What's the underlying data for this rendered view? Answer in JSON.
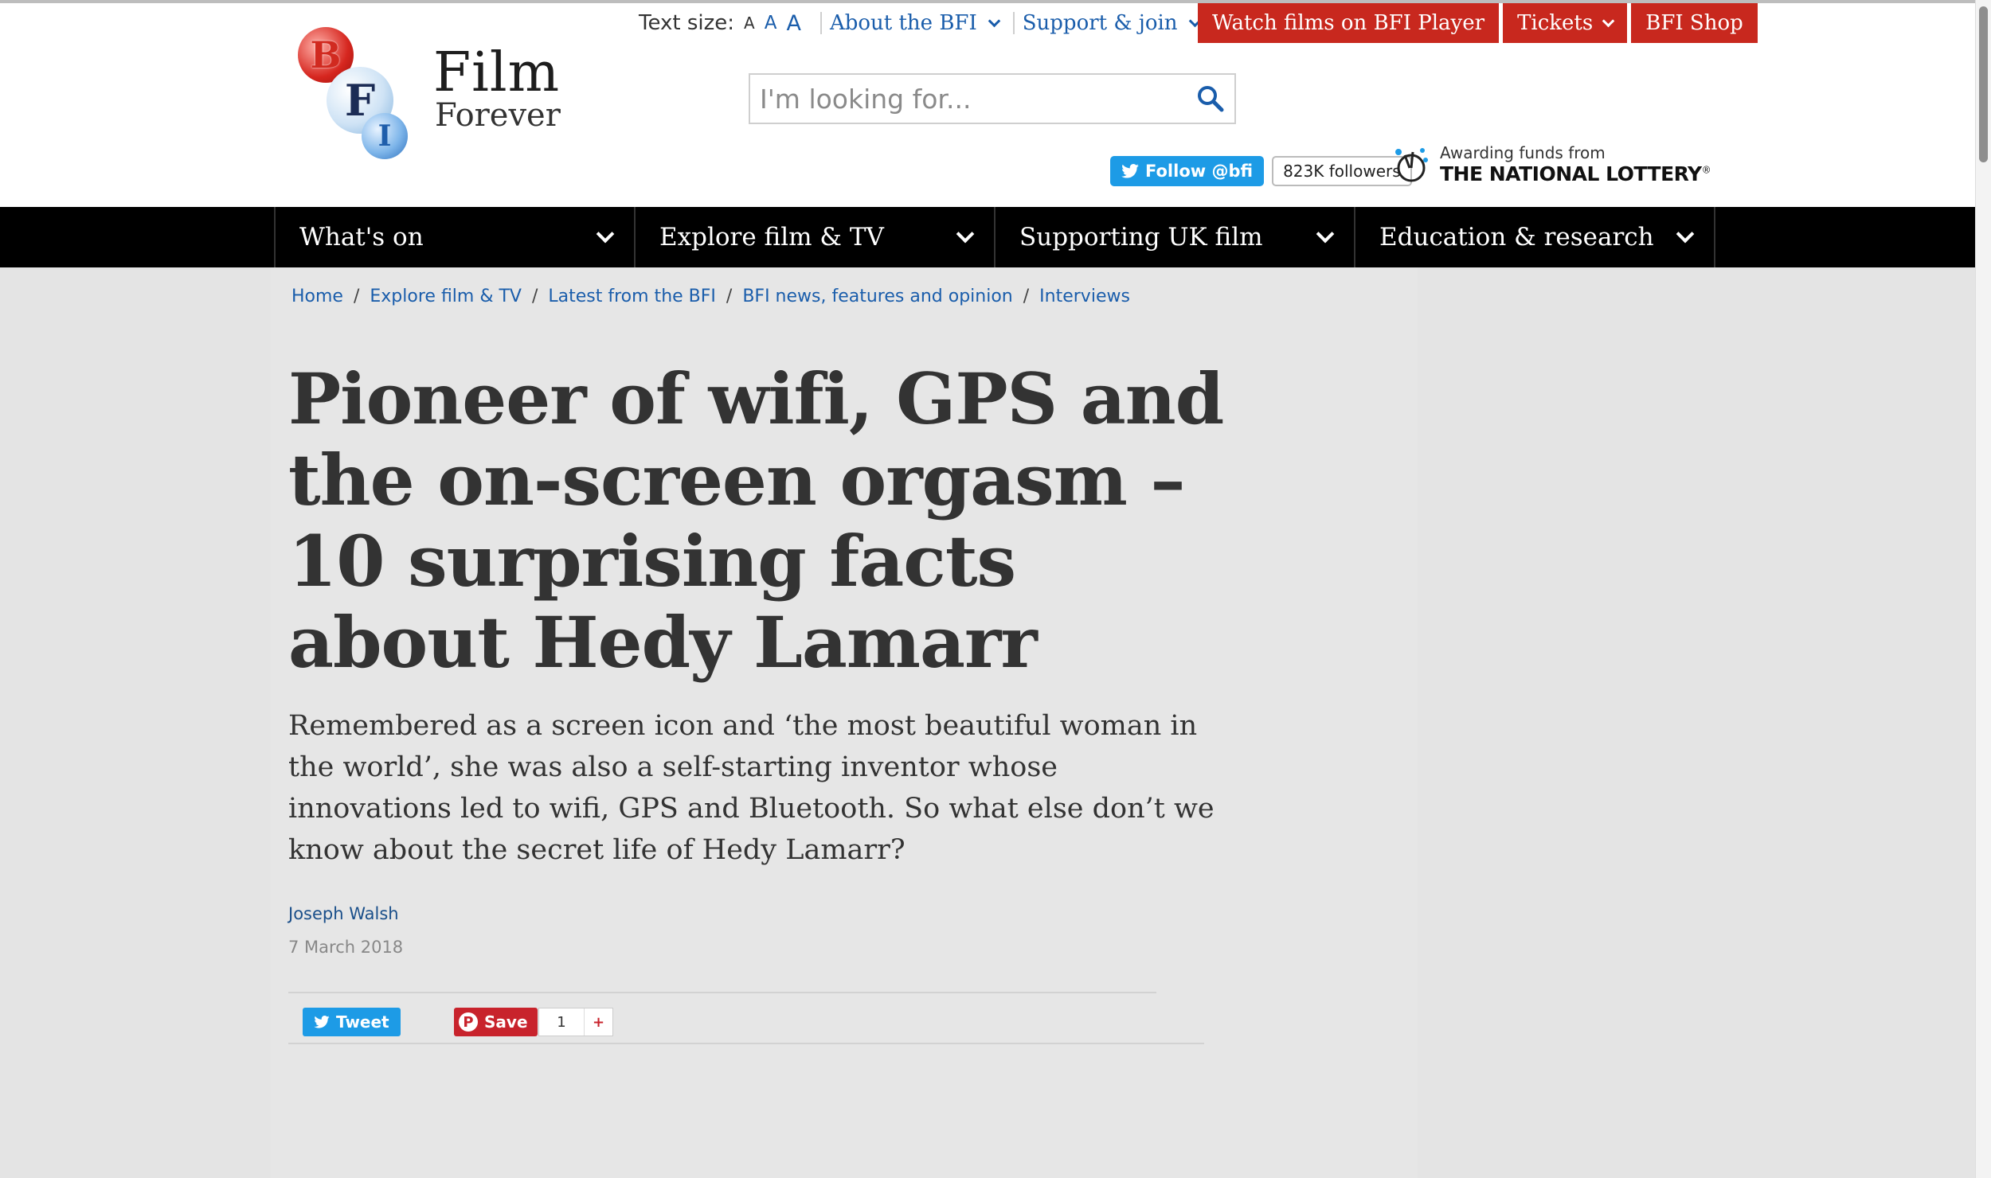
{
  "brand": {
    "logo_letters": [
      "B",
      "F",
      "I"
    ],
    "logo_line1": "Film",
    "logo_line2": "Forever",
    "red": "#c8281e",
    "link_blue": "#1a5dab"
  },
  "utility": {
    "text_size_label": "Text size:",
    "text_size_options": [
      "A",
      "A",
      "A"
    ],
    "about": "About the BFI",
    "support": "Support & join"
  },
  "actions": {
    "watch": "Watch films on BFI Player",
    "tickets": "Tickets",
    "shop": "BFI Shop"
  },
  "search": {
    "placeholder": "I'm looking for...",
    "icon": "search-icon"
  },
  "social": {
    "follow": "Follow @bfi",
    "followers": "823K followers"
  },
  "lottery": {
    "line1": "Awarding funds from",
    "line2": "THE NATIONAL LOTTERY",
    "mark": "®"
  },
  "nav": [
    {
      "label": "What's on"
    },
    {
      "label": "Explore film & TV"
    },
    {
      "label": "Supporting UK film"
    },
    {
      "label": "Education & research"
    }
  ],
  "breadcrumb": [
    "Home",
    "Explore film & TV",
    "Latest from the BFI",
    "BFI news, features and opinion",
    "Interviews"
  ],
  "article": {
    "title": "Pioneer of wifi, GPS and the on-screen orgasm – 10 surprising facts about Hedy Lamarr",
    "standfirst": "Remembered as a screen icon and ‘the most beautiful woman in the world’, she was also a self-starting inventor whose innovations led to wifi, GPS and Bluetooth. So what else don’t we know about the secret life of Hedy Lamarr?",
    "author": "Joseph Walsh",
    "date": "7 March 2018"
  },
  "share": {
    "tweet": "Tweet",
    "save": "Save",
    "save_count": "1",
    "plus": "+"
  }
}
